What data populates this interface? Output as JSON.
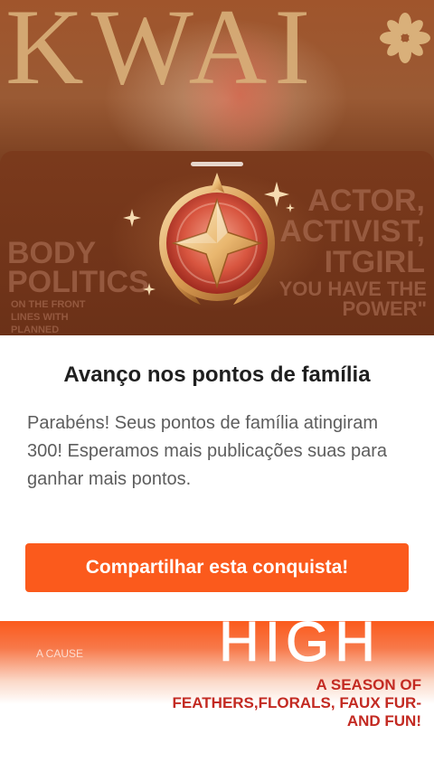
{
  "background": {
    "magazine_title": "KWAI",
    "left_text_1": "BODY",
    "left_text_2": "POLITICS",
    "left_small": "ON THE FRONT LINES WITH PLANNED",
    "right_text": "ACTOR, ACTIVIST, ITGIRL",
    "right_quote": "YOU HAVE THE POWER\"",
    "bottom_big": "HIGH",
    "bottom_tagline": "A SEASON OF FEATHERS,FLORALS, FAUX FUR-AND FUN!",
    "bottom_small": "A CAUSE"
  },
  "dialog": {
    "title": "Avanço nos pontos de família",
    "message": "Parabéns! Seus pontos de família atingiram 300! Esperamos mais publicações suas para ganhar mais pontos.",
    "share_button": "Compartilhar esta conquista!"
  },
  "icons": {
    "badge": "gold-star-medal-icon",
    "sparkle": "sparkle-icon",
    "grabber": "drag-handle"
  },
  "colors": {
    "accent": "#fb5a1c",
    "title": "#1f1f1f",
    "message": "#5d5d5d",
    "hero_bg": "#6b3118",
    "gold": "#e9b76f"
  }
}
